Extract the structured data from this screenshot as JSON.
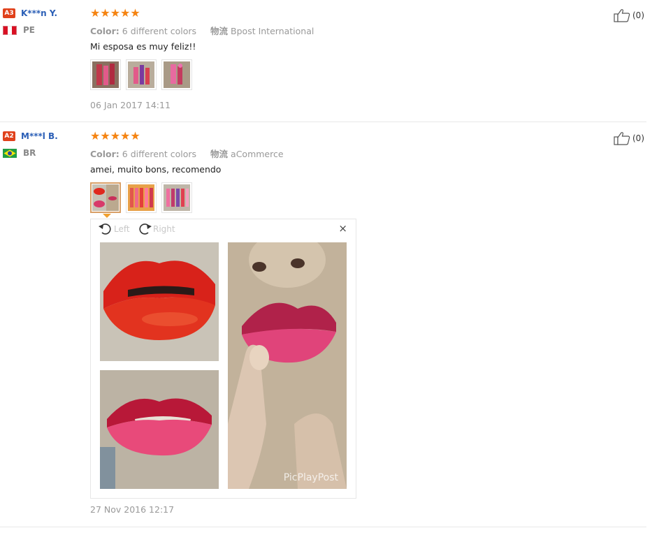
{
  "reviews": [
    {
      "level": "A3",
      "user": "K***n Y.",
      "country": "PE",
      "stars": "★★★★★",
      "color_label": "Color:",
      "color_value": "6 different colors",
      "logistics_label": "物流",
      "logistics_value": "Bpost International",
      "text": "Mi esposa es muy feliz!!",
      "date": "06 Jan 2017 14:11",
      "helpful": "(0)"
    },
    {
      "level": "A2",
      "user": "M***l B.",
      "country": "BR",
      "stars": "★★★★★",
      "color_label": "Color:",
      "color_value": "6 different colors",
      "logistics_label": "物流",
      "logistics_value": "aCommerce",
      "text": "amei, muito bons, recomendo",
      "date": "27 Nov 2016 12:17",
      "helpful": "(0)"
    }
  ],
  "viewer": {
    "rotate_left": "Left",
    "rotate_right": "Right",
    "close": "×",
    "watermark": "PicPlayPost"
  },
  "colors": {
    "username": "#2a5eb6",
    "level_badge": "#e0411b",
    "stars": "#f58412",
    "active_thumb": "#d9a068"
  }
}
